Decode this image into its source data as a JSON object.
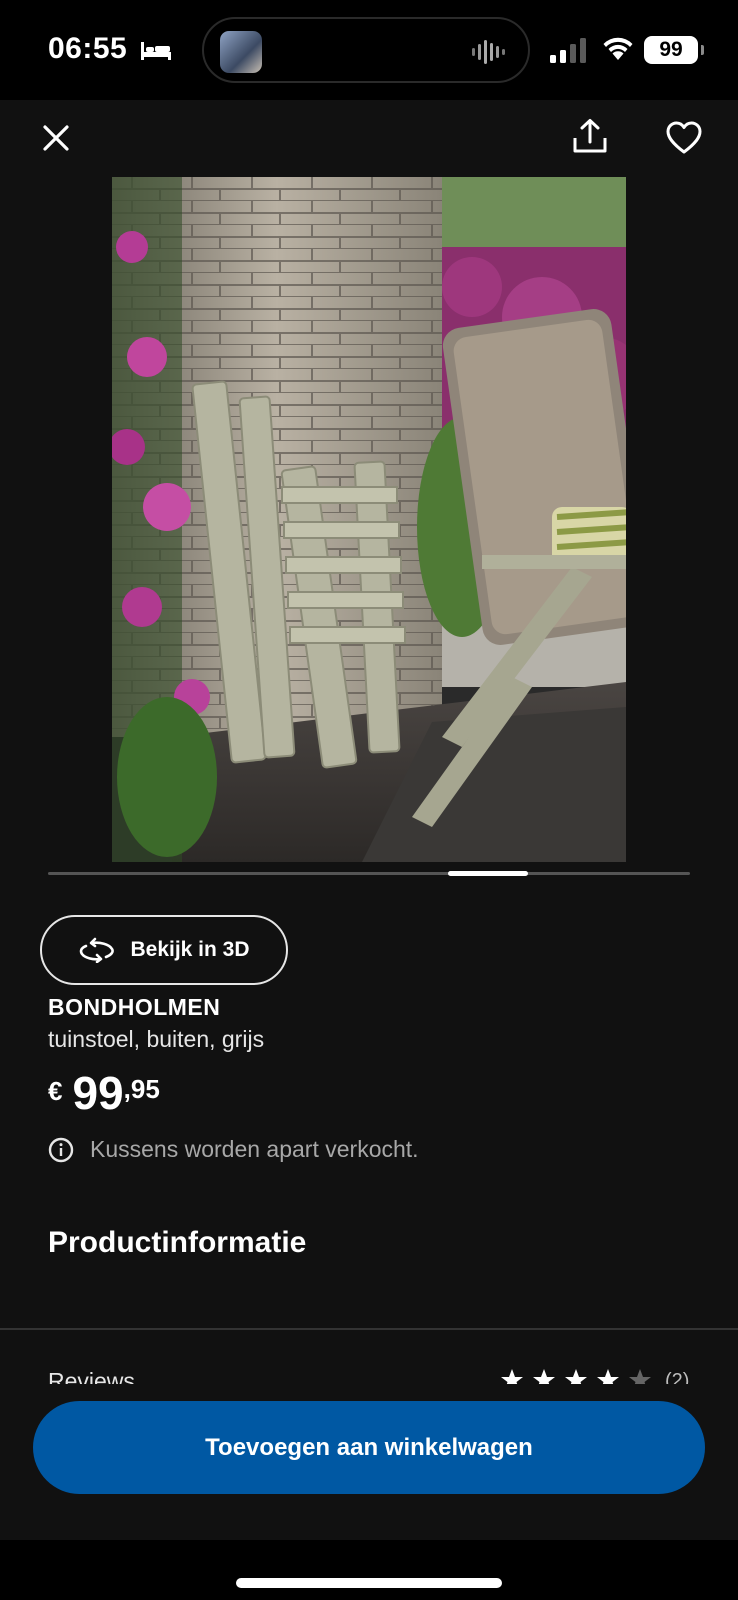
{
  "status_bar": {
    "time": "06:55",
    "battery": "99"
  },
  "toolbar": {
    "close_icon": "close-icon",
    "share_icon": "share-icon",
    "favorite_icon": "heart-icon"
  },
  "gallery": {
    "image_description_icon": "product-photo"
  },
  "view_3d": {
    "label": "Bekijk in 3D"
  },
  "product": {
    "name": "BONDHOLMEN",
    "description": "tuinstoel, buiten, grijs",
    "price_currency": "€",
    "price_integer": "99",
    "price_decimal": ",95",
    "notice": "Kussens worden apart verkocht."
  },
  "sections": {
    "product_info": "Productinformatie",
    "reviews_label": "Reviews",
    "reviews_count": "(2)",
    "rating": 4.5
  },
  "cart": {
    "button_label": "Toevoegen aan winkelwagen"
  },
  "colors": {
    "background": "#111111",
    "primary_button": "#0058a3"
  }
}
